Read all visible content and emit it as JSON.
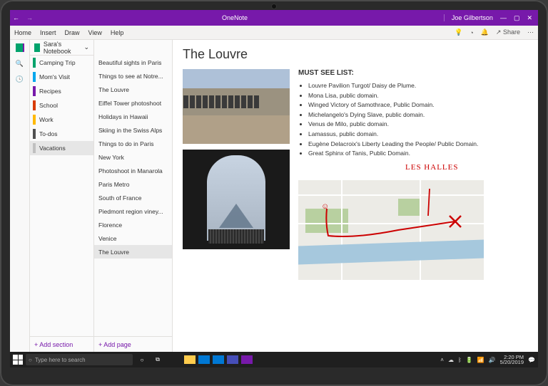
{
  "titlebar": {
    "app": "OneNote",
    "user": "Joe Gilbertson"
  },
  "ribbon": {
    "tabs": [
      "Home",
      "Insert",
      "Draw",
      "View",
      "Help"
    ],
    "share": "Share"
  },
  "notebook": {
    "name": "Sara's Notebook"
  },
  "sections": [
    {
      "label": "Camping Trip",
      "color": "#00a36c"
    },
    {
      "label": "Mom's Visit",
      "color": "#00a6ed"
    },
    {
      "label": "Recipes",
      "color": "#7719aa"
    },
    {
      "label": "School",
      "color": "#d83b01"
    },
    {
      "label": "Work",
      "color": "#ffb900"
    },
    {
      "label": "To-dos",
      "color": "#505050"
    },
    {
      "label": "Vacations",
      "color": "#c0c0c0",
      "selected": true
    }
  ],
  "add_section": "+  Add section",
  "pages": [
    "Beautiful sights in Paris",
    "Things to see at Notre...",
    "The Louvre",
    "Eiffel Tower photoshoot",
    "Holidays in Hawaii",
    "Skiing in the Swiss Alps",
    "Things to do in Paris",
    "New York",
    "Photoshoot in Manarola",
    "Paris Metro",
    "South of France",
    "Piedmont region viney...",
    "Florence",
    "Venice",
    "The Louvre"
  ],
  "selected_page_index": 14,
  "add_page": "+  Add page",
  "content": {
    "title": "The Louvre",
    "heading": "MUST SEE LIST:",
    "items": [
      "Louvre Pavilion Turgot/ Daisy de Plume.",
      "Mona Lisa, public domain.",
      "Winged Victory of Samothrace, Public Domain.",
      "Michelangelo's Dying Slave, public domain.",
      "Venus de Milo, public domain.",
      "Lamassus, public domain.",
      "Eugène Delacroix's Liberty Leading the People/ Public Domain.",
      "Great Sphinx of Tanis, Public Domain."
    ],
    "ink_label": "LES HALLES"
  },
  "taskbar": {
    "search_placeholder": "Type here to search",
    "time": "2:20 PM",
    "date": "5/20/2019"
  }
}
